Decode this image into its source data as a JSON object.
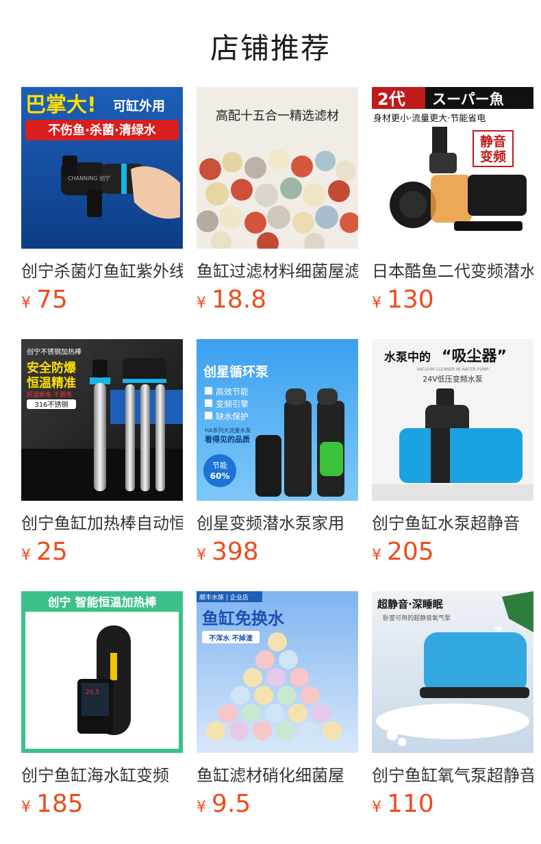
{
  "header": {
    "title": "店铺推荐"
  },
  "currency": "¥",
  "products": [
    {
      "title": "创宁杀菌灯鱼缸紫外线",
      "price": "75",
      "image_text": [
        "巴掌大!",
        "可缸外用",
        "不伤鱼·杀菌·清绿水",
        "CHANNING 创宁"
      ]
    },
    {
      "title": "鱼缸过滤材料细菌屋滤",
      "price": "18.8",
      "image_text": [
        "高配十五合一精选滤材"
      ]
    },
    {
      "title": "日本酷鱼二代变频潜水",
      "price": "130",
      "image_text": [
        "2代",
        "スーパー魚",
        "身材更小·流量更大·节能省电",
        "静音",
        "变频"
      ]
    },
    {
      "title": "创宁鱼缸加热棒自动恒",
      "price": "25",
      "image_text": [
        "创宁不锈钢加热棒",
        "安全防爆",
        "恒温精准",
        "超温断电 不漏电",
        "316不锈钢"
      ]
    },
    {
      "title": "创星变频潜水泵家用",
      "price": "398",
      "image_text": [
        "创星循环泵",
        "高效节能",
        "变频引擎",
        "缺水保护",
        "HA系列大流量水泵",
        "看得见的品质",
        "节能",
        "60%"
      ]
    },
    {
      "title": "创宁鱼缸水泵超静音",
      "price": "205",
      "image_text": [
        "水泵中的",
        "“吸尘器”",
        "VACUUM CLEANER IN WATER PUMP",
        "24V低压变频水泵"
      ]
    },
    {
      "title": "创宁鱼缸海水缸变频",
      "price": "185",
      "image_text": [
        "创宁 智能恒温加热棒"
      ]
    },
    {
      "title": "鱼缸滤材硝化细菌屋",
      "price": "9.5",
      "image_text": [
        "顺丰水族 | 企业店",
        "鱼缸免换水",
        "不浑水 不掉渣"
      ]
    },
    {
      "title": "创宁鱼缸氧气泵超静音",
      "price": "110",
      "image_text": [
        "超静音·深睡眠",
        "卧室可用的超静音氧气泵"
      ]
    }
  ]
}
